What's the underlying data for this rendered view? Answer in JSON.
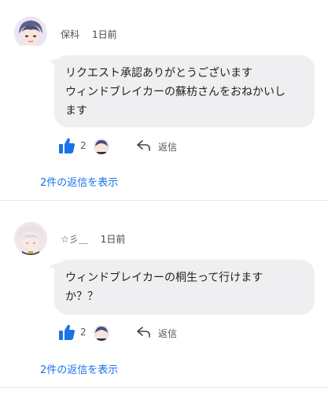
{
  "comments": [
    {
      "author": "保科",
      "time": "1日前",
      "text_lines": [
        "リクエスト承認ありがとうございます",
        "ウィンドブレイカーの蘇枋さんをおねかいし",
        "ます"
      ],
      "like_count": "2",
      "reply_label": "返信",
      "show_replies": "2件の返信を表示"
    },
    {
      "author": "☆彡＿",
      "time": "1日前",
      "text_lines": [
        "ウィンドブレイカーの桐生って行けます",
        "か？？"
      ],
      "like_count": "2",
      "reply_label": "返信",
      "show_replies": "2件の返信を表示"
    }
  ],
  "colors": {
    "accent": "#1a73e8",
    "bubble": "#efeff1",
    "divider": "#e6e6e6"
  },
  "icons": {
    "like": "thumbs-up-icon",
    "reply": "reply-arrow-icon"
  }
}
